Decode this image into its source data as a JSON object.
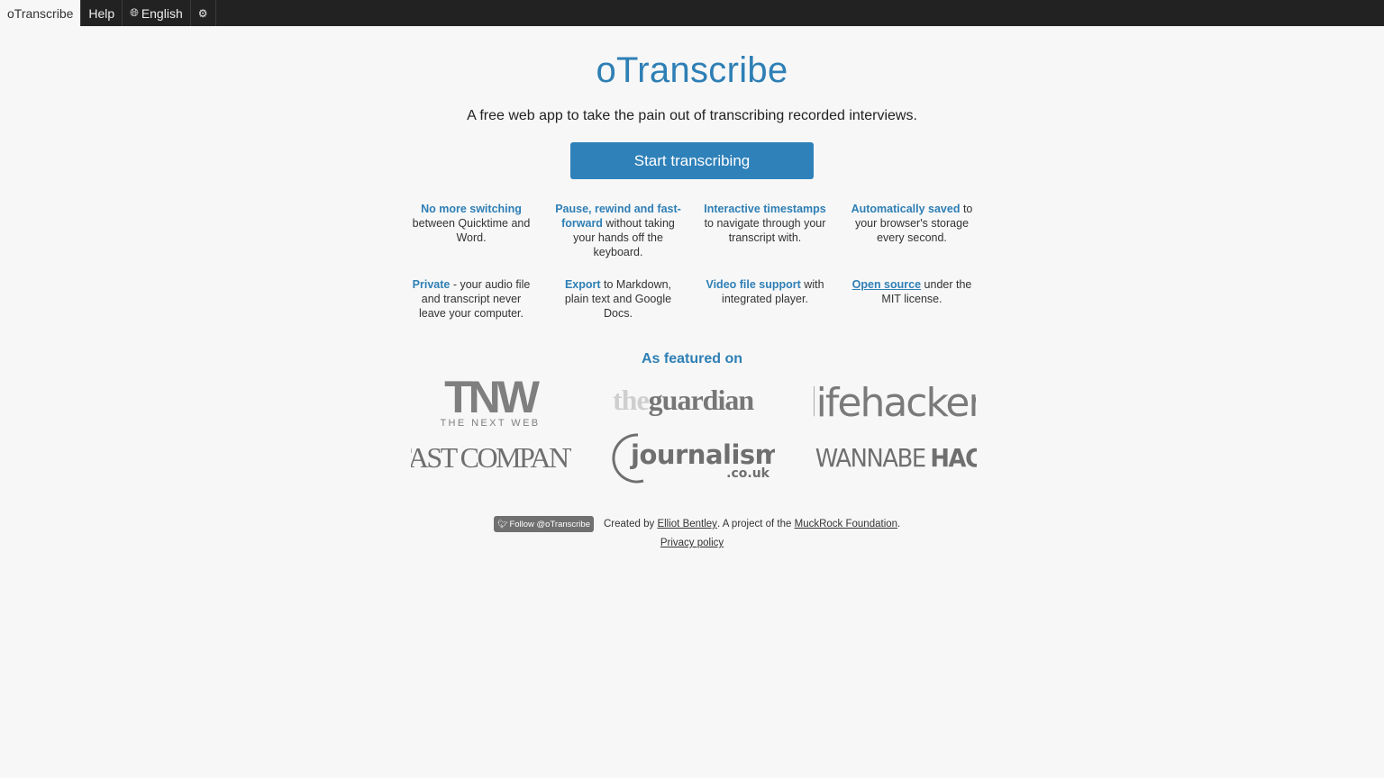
{
  "nav": {
    "brand": "oTranscribe",
    "help": "Help",
    "language": "English"
  },
  "hero": {
    "title": "oTranscribe",
    "tagline": "A free web app to take the pain out of transcribing recorded interviews.",
    "start_label": "Start transcribing"
  },
  "features": [
    {
      "highlight": "No more switching",
      "text": " between Quicktime and Word."
    },
    {
      "highlight": "Pause, rewind and fast-forward",
      "text": " without taking your hands off the keyboard."
    },
    {
      "highlight": "Interactive timestamps",
      "text": " to navigate through your transcript with."
    },
    {
      "highlight": "Automatically saved",
      "text": " to your browser's storage every second."
    },
    {
      "highlight": "Private",
      "text": " - your audio file and transcript never leave your computer."
    },
    {
      "highlight": "Export",
      "text": " to Markdown, plain text and Google Docs."
    },
    {
      "highlight": "Video file support",
      "text": " with integrated player."
    },
    {
      "highlight": "Open source",
      "text": " under the MIT license."
    }
  ],
  "featured": {
    "title": "As featured on",
    "logos": {
      "tnw": {
        "mark": "TNW",
        "sub": "THE NEXT WEB"
      },
      "guardian": {
        "pre": "the",
        "main": "guardian"
      },
      "lifehacker": "lifehacker",
      "fastcompany": "FAST COMPANY",
      "journalism": {
        "main": "journalism",
        "sub": ".co.uk"
      },
      "wannabe": {
        "a": "WANNABE",
        "b": "HACKS"
      }
    }
  },
  "footer": {
    "follow_label": "Follow @oTranscribe",
    "created_by": "Created by ",
    "author": "Elliot Bentley",
    "project_of": ". A project of the ",
    "org": "MuckRock Foundation",
    "end": ".",
    "privacy": "Privacy policy"
  },
  "colors": {
    "accent": "#2e7fb5",
    "button": "#2f81b9",
    "topbar": "#222222",
    "background": "#f7f7f7"
  }
}
